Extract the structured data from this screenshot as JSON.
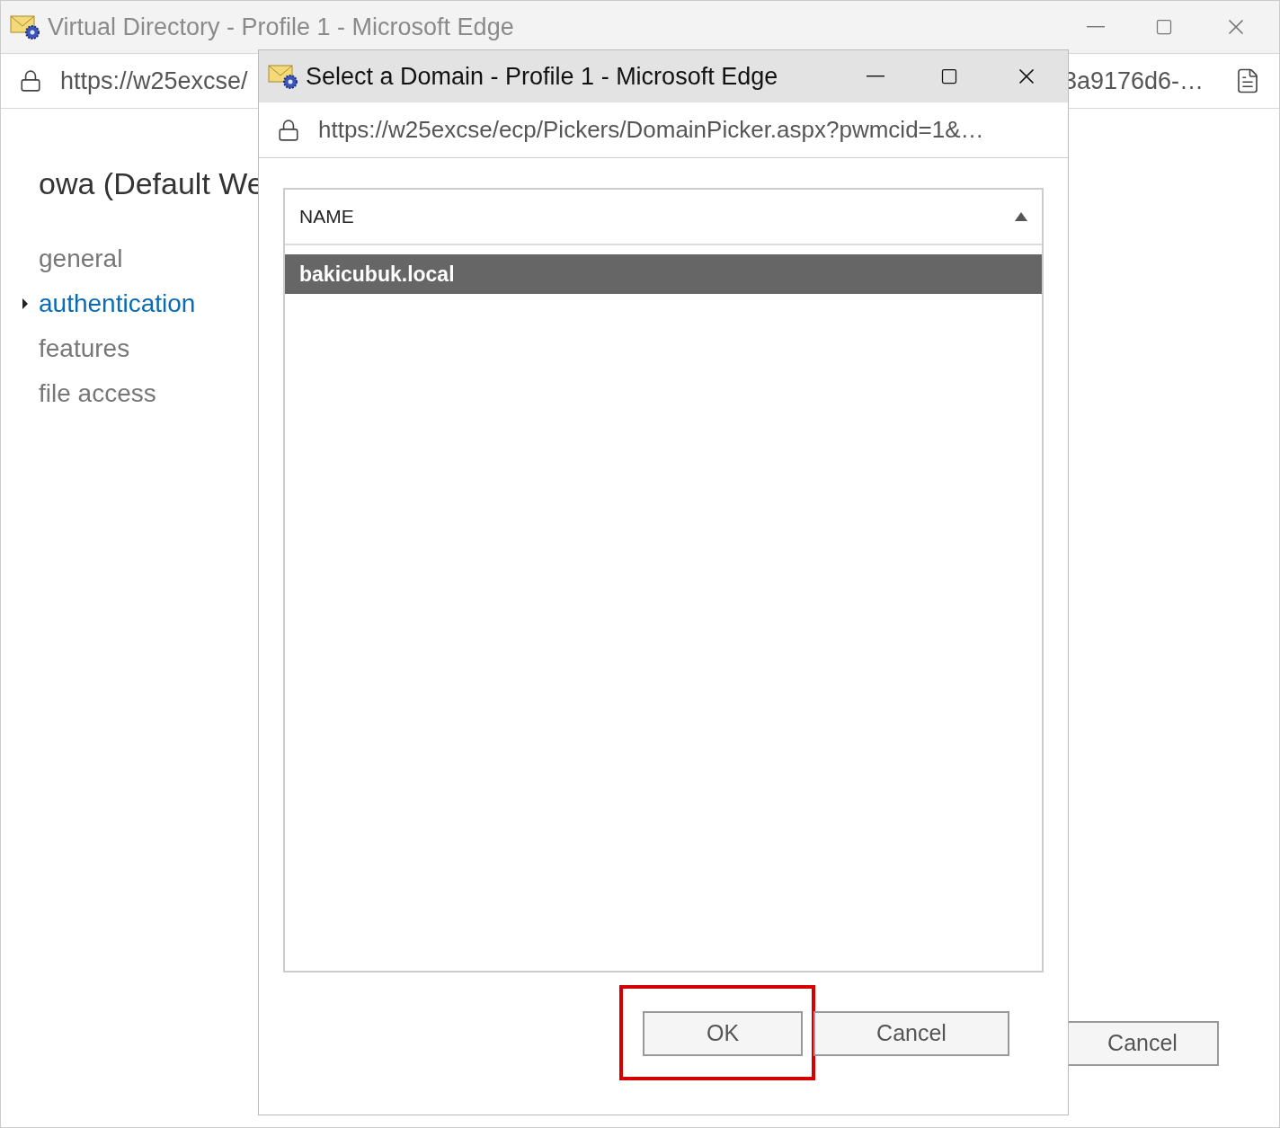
{
  "main_window": {
    "title": "Virtual Directory - Profile 1 - Microsoft Edge",
    "url_start": "https://w25excse/",
    "url_end": "3a9176d6-…",
    "heading": "owa (Default We",
    "nav": [
      {
        "label": "general",
        "selected": false
      },
      {
        "label": "authentication",
        "selected": true
      },
      {
        "label": "features",
        "selected": false
      },
      {
        "label": "file access",
        "selected": false
      }
    ],
    "buttons": [
      {
        "label": "Cancel"
      }
    ]
  },
  "dialog": {
    "title": "Select a Domain - Profile 1 - Microsoft Edge",
    "url": "https://w25excse/ecp/Pickers/DomainPicker.aspx?pwmcid=1&…",
    "list": {
      "columns": [
        {
          "label": "NAME",
          "sorted_ascending": true
        }
      ],
      "rows": [
        {
          "name": "bakicubuk.local",
          "selected": true
        }
      ]
    },
    "buttons": [
      {
        "label": "OK",
        "highlighted": true
      },
      {
        "label": "Cancel",
        "highlighted": false
      }
    ]
  }
}
